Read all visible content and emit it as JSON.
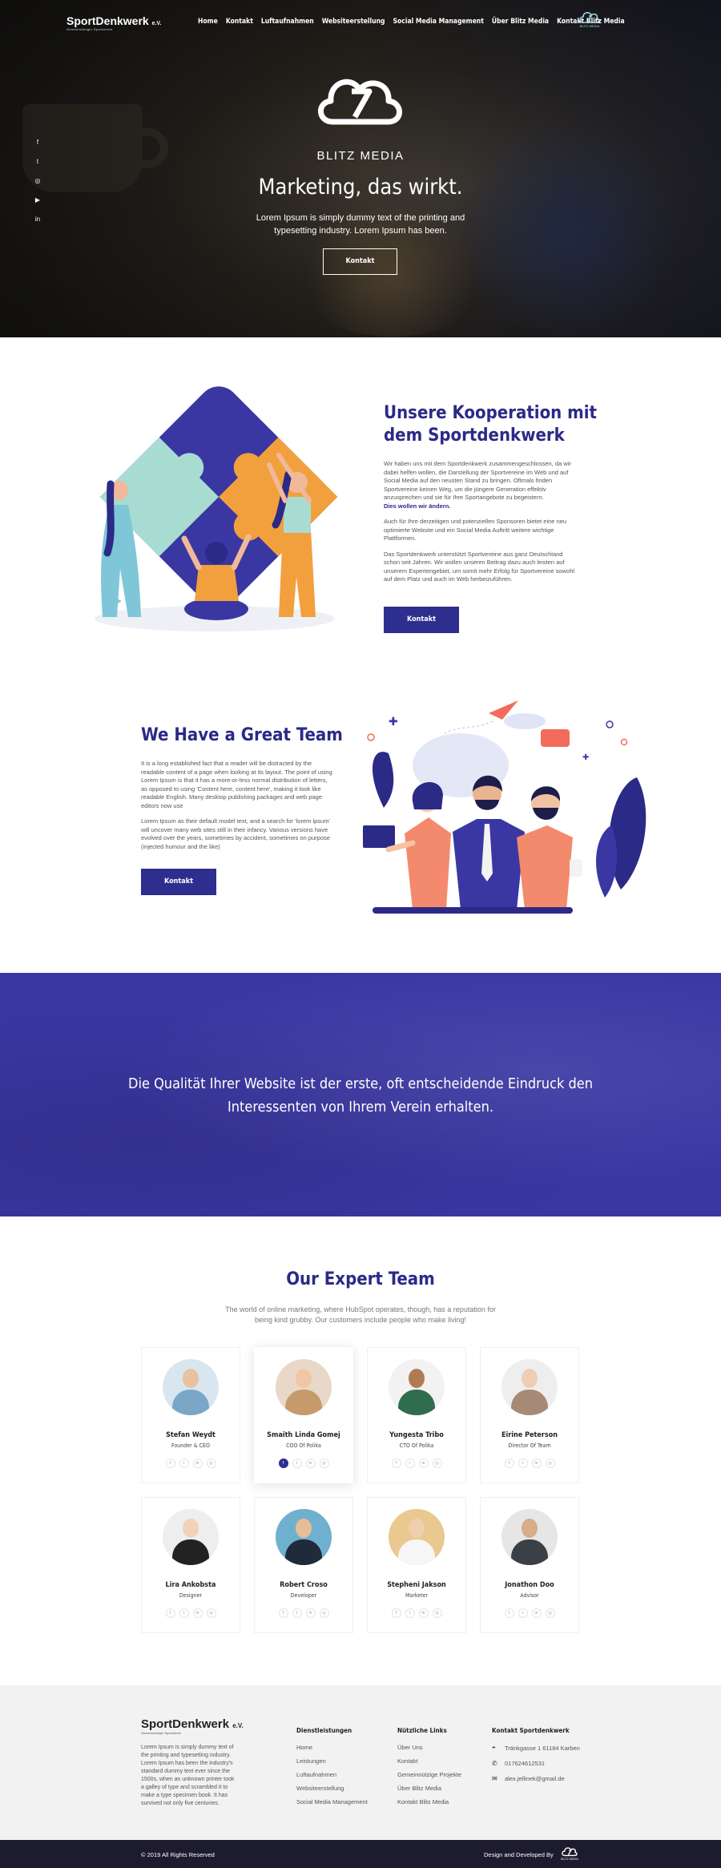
{
  "nav": {
    "logo_text": "SportDenkwerk",
    "logo_suffix": "e.V.",
    "logo_sub": "Gemeinnütziger Sportverein",
    "items": [
      "Home",
      "Kontakt",
      "Luftaufnahmen",
      "Websiteerstellung",
      "Social Media Management",
      "Über Blitz Media",
      "Kontakt Blitz Media"
    ],
    "partner_label": "BLITZ MEDIA"
  },
  "social": [
    "f",
    "t",
    "◎",
    "▶",
    "in"
  ],
  "hero": {
    "brand": "BLITZ MEDIA",
    "title": "Marketing, das wirkt.",
    "text": "Lorem Ipsum is simply dummy text of the printing and typesetting industry. Lorem Ipsum has been.",
    "button": "Kontakt"
  },
  "kooperation": {
    "title": "Unsere Kooperation mit dem Sportdenkwerk",
    "p1": "Wir haben uns mit dem Sportdenkwerk zusammengeschlossen, da wir dabei helfen wollen, die Darstellung der Sportvereine im Web und auf Social Media auf den neusten Stand zu bringen. Oftmals finden Sportvereine keinen Weg, um die jüngere Generation effektiv anzusprechen und sie für Ihre Sportangebote zu begeistern.",
    "p1_bold": "Dies wollen wir ändern.",
    "p2": "Auch für Ihre derzeitigen und potenziellen Sponsoren bietet eine neu optimierte Website und ein Social Media Auftritt weitere wichtige Plattformen.",
    "p3": "Das Sportdenkwerk unterstützt Sportvereine aus ganz Deutschland schon seit Jahren. Wir wollen unseren Beitrag dazu auch leisten auf unserem Expertengebiet, um somit mehr Erfolg für Sportvereine sowohl auf dem Platz und auch im Web herbeizuführen.",
    "button": "Kontakt"
  },
  "team": {
    "title": "We Have a Great Team",
    "p1": "It is a long established fact that a reader will be distracted by the readable content of a page when looking at its layout. The point of using Lorem Ipsum is that it has a more-or-less normal distribution of letters, as opposed to using 'Content here, content here', making it look like readable English. Many desktop publishing packages and web page editors now use",
    "p2": "Lorem Ipsum as their default model text, and a search for 'lorem ipsum' will uncover many web sites still in their infancy. Various versions have evolved over the years, sometimes by accident, sometimes on purpose (injected humour and the like)",
    "button": "Kontakt"
  },
  "quote": {
    "text": "Die Qualität Ihrer Website ist der erste, oft entscheidende Eindruck den Interessenten von Ihrem Verein erhalten."
  },
  "experts": {
    "title": "Our Expert Team",
    "subtitle": "The world of online marketing, where HubSpot operates, though, has a reputation for being kind grubby. Our customers include people who make living!",
    "members": [
      {
        "name": "Stefan Weydt",
        "role": "Founder & CEO",
        "bg": "#d9e6ef",
        "skin": "#e8c1a0",
        "shirt": "#7aa7c7"
      },
      {
        "name": "Smaith Linda Gomej",
        "role": "COO Of Polika",
        "bg": "#e9d8c8",
        "skin": "#f0c7a6",
        "shirt": "#c79a6b"
      },
      {
        "name": "Yungesta Tribo",
        "role": "CTO Of Polika",
        "bg": "#f2f2f2",
        "skin": "#b07a55",
        "shirt": "#2f6d4c"
      },
      {
        "name": "Eirine Peterson",
        "role": "Director Of Team",
        "bg": "#eeeeee",
        "skin": "#efcdb4",
        "shirt": "#a78a75"
      },
      {
        "name": "Lira Ankobsta",
        "role": "Designer",
        "bg": "#eeeeee",
        "skin": "#f2d2b8",
        "shirt": "#222222"
      },
      {
        "name": "Robert Croso",
        "role": "Developer",
        "bg": "#6fb0cf",
        "skin": "#e7bd98",
        "shirt": "#1f2a3a"
      },
      {
        "name": "Stepheni Jakson",
        "role": "Marketer",
        "bg": "#e9c98f",
        "skin": "#f0cfb0",
        "shirt": "#f6f6f6"
      },
      {
        "name": "Jonathon Doo",
        "role": "Advisor",
        "bg": "#e6e6e6",
        "skin": "#d7ad8a",
        "shirt": "#3b3f46"
      }
    ]
  },
  "footer": {
    "logo_text": "SportDenkwerk",
    "logo_suffix": "e.V.",
    "logo_sub": "Gemeinnütziger Sportverein",
    "about": "Lorem Ipsum is simply dummy text of the printing and typesetting industry. Lorem Ipsum has been the industry's standard dummy text ever since the 1500s, when an unknown printer took a galley of type and scrambled it to make a type specimen book. It has survived not only five centuries.",
    "col1_title": "Dienstleistungen",
    "col1": [
      "Home",
      "Leistungen",
      "Luftaufnahmen",
      "Websiteerstellung",
      "Social Media Management"
    ],
    "col2_title": "Nützliche Links",
    "col2": [
      "Über Uns",
      "Kontakt",
      "Gemeinnützige Projekte",
      "Über Blitz Media",
      "Kontakt Blitz Media"
    ],
    "col3_title": "Kontakt Sportdenkwerk",
    "address": "Tränkgasse 1 61184 Karben",
    "phone": "017624612531",
    "email": "alex.jellinek@gmail.de",
    "copyright": "© 2019 All Rights Reserved",
    "developed": "Design and Developed By",
    "dev_logo": "BLITZ MEDIA"
  }
}
